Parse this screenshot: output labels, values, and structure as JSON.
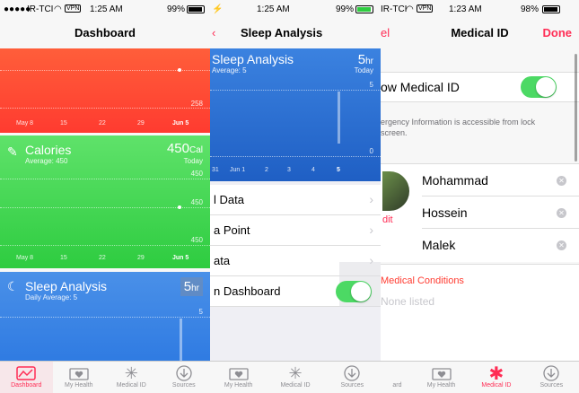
{
  "colors": {
    "accent": "#ff2d55",
    "red": "#ff3b30",
    "green": "#4cd964",
    "blue": "#2f7be2",
    "toggle": "#4cd964"
  },
  "panel1": {
    "status": {
      "carrier": "IR-TCI",
      "vpn": "VPN",
      "time": "1:25 AM",
      "battery": "99%"
    },
    "title": "Dashboard",
    "red_card": {
      "value": "258",
      "x_ticks": [
        "May 8",
        "15",
        "22",
        "29",
        "Jun 5"
      ]
    },
    "calories": {
      "title": "Calories",
      "subtitle": "Average: 450",
      "value": "450",
      "unit": "Cal",
      "date": "Today",
      "grid": [
        "450",
        "450",
        "450"
      ],
      "x_ticks": [
        "May 8",
        "15",
        "22",
        "29",
        "Jun 5"
      ]
    },
    "sleep": {
      "title": "Sleep Analysis",
      "subtitle": "Daily Average: 5",
      "value": "5",
      "unit": "hr",
      "grid_top": "5"
    },
    "tabs": [
      {
        "label": "Dashboard",
        "icon": "dashboard-icon"
      },
      {
        "label": "My Health",
        "icon": "folder-heart-icon"
      },
      {
        "label": "Medical ID",
        "icon": "asterisk-icon"
      },
      {
        "label": "Sources",
        "icon": "download-icon"
      }
    ]
  },
  "panel2": {
    "status": {
      "time": "1:25 AM",
      "battery": "99%"
    },
    "title": "Sleep Analysis",
    "chart": {
      "title": "Sleep Analysis",
      "subtitle": "Average: 5",
      "value": "5",
      "unit": "hr",
      "date": "Today",
      "top": "5",
      "bottom": "0",
      "x_ticks": [
        "31",
        "Jun 1",
        "2",
        "3",
        "4",
        "5"
      ]
    },
    "rows": [
      "l Data",
      "a Point",
      "ata",
      "n Dashboard"
    ],
    "tabs": [
      {
        "label": "My Health",
        "icon": "folder-heart-icon"
      },
      {
        "label": "Medical ID",
        "icon": "asterisk-icon"
      },
      {
        "label": "Sources",
        "icon": "download-icon"
      }
    ]
  },
  "panel3": {
    "status": {
      "carrier": "IR-TCI",
      "vpn": "VPN",
      "time": "1:23 AM",
      "battery": "98%"
    },
    "back": "el",
    "title": "Medical ID",
    "done": "Done",
    "show_label": "ow Medical ID",
    "info": "ergency Information is accessible from lock screen.",
    "edit": "dit",
    "names": [
      "Mohammad",
      "Hossein",
      "Malek"
    ],
    "conditions_title": "Medical Conditions",
    "conditions_value": "None listed",
    "tabs": [
      {
        "label": "ard",
        "icon": "dashboard-icon"
      },
      {
        "label": "My Health",
        "icon": "folder-heart-icon"
      },
      {
        "label": "Medical ID",
        "icon": "asterisk-icon"
      },
      {
        "label": "Sources",
        "icon": "download-icon"
      }
    ]
  }
}
